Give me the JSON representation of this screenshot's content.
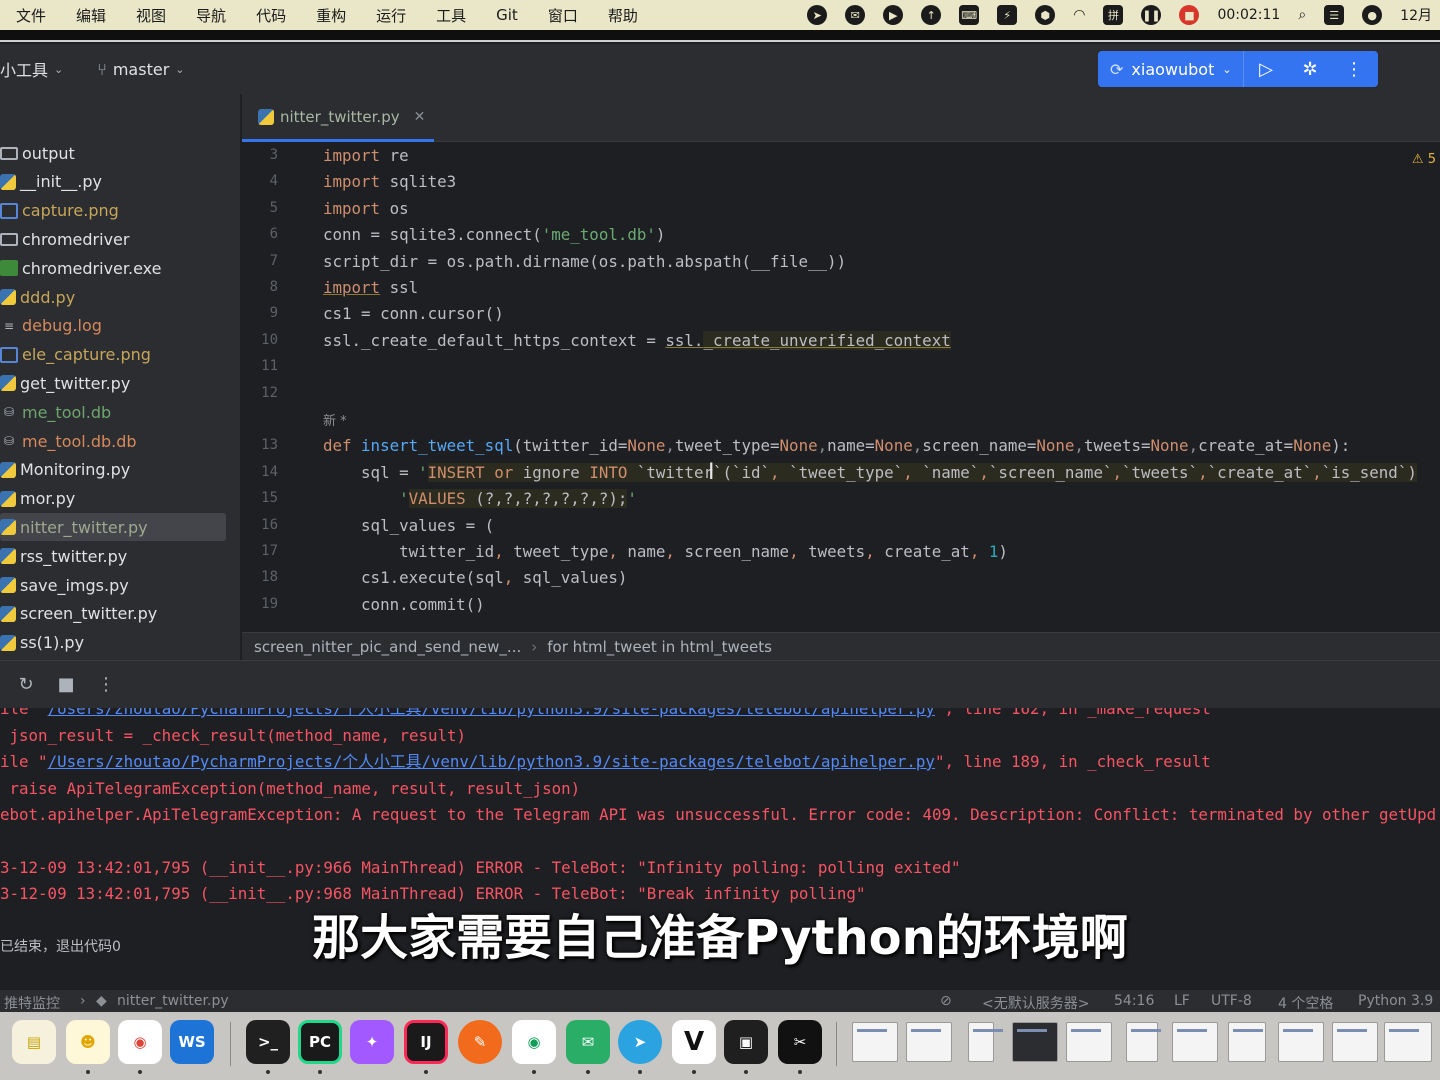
{
  "menubar": {
    "items": [
      "文件",
      "编辑",
      "视图",
      "导航",
      "代码",
      "重构",
      "运行",
      "工具",
      "Git",
      "窗口",
      "帮助"
    ],
    "clock": "00:02:11",
    "date": "12月"
  },
  "toolbar": {
    "project": "小工具",
    "branch": "master",
    "run_config": "xiaowubot"
  },
  "project_tree": [
    {
      "name": "output",
      "icon": "folder-icon",
      "color": "#dfe1e5"
    },
    {
      "name": "__init__.py",
      "icon": "python-file-icon",
      "color": "#dfe1e5"
    },
    {
      "name": "capture.png",
      "icon": "image-file-icon",
      "color": "#c7a65a"
    },
    {
      "name": "chromedriver",
      "icon": "file-icon",
      "color": "#dfe1e5"
    },
    {
      "name": "chromedriver.exe",
      "icon": "exe-file-icon",
      "color": "#dfe1e5"
    },
    {
      "name": "ddd.py",
      "icon": "python-file-icon",
      "color": "#c7a65a"
    },
    {
      "name": "debug.log",
      "icon": "text-file-icon",
      "color": "#d7895c"
    },
    {
      "name": "ele_capture.png",
      "icon": "image-file-icon",
      "color": "#c7a65a"
    },
    {
      "name": "get_twitter.py",
      "icon": "python-file-icon",
      "color": "#dfe1e5"
    },
    {
      "name": "me_tool.db",
      "icon": "database-icon",
      "color": "#6ea56e"
    },
    {
      "name": "me_tool.db.db",
      "icon": "database-icon",
      "color": "#d7895c"
    },
    {
      "name": "Monitoring.py",
      "icon": "python-file-icon",
      "color": "#dfe1e5"
    },
    {
      "name": "mor.py",
      "icon": "python-file-icon",
      "color": "#dfe1e5"
    },
    {
      "name": "nitter_twitter.py",
      "icon": "python-file-icon",
      "color": "#9fa88f"
    },
    {
      "name": "rss_twitter.py",
      "icon": "python-file-icon",
      "color": "#dfe1e5"
    },
    {
      "name": "save_imgs.py",
      "icon": "python-file-icon",
      "color": "#dfe1e5"
    },
    {
      "name": "screen_twitter.py",
      "icon": "python-file-icon",
      "color": "#dfe1e5"
    },
    {
      "name": "ss(1).py",
      "icon": "python-file-icon",
      "color": "#dfe1e5"
    }
  ],
  "editor": {
    "tab": "nitter_twitter.py",
    "warning_count": "5",
    "line_numbers": [
      "3",
      "4",
      "5",
      "6",
      "7",
      "8",
      "9",
      "10",
      "11",
      "12",
      "13",
      "14",
      "15",
      "16",
      "17",
      "18",
      "19"
    ],
    "hint_new": "新 *",
    "breadcrumbs": [
      "screen_nitter_pic_and_send_new_...",
      "for html_tweet in html_tweets"
    ]
  },
  "console": {
    "lines": [
      {
        "kind": "file",
        "prefix": "ile \"",
        "path": "/Users/zhoutao/PycharmProjects/个人小工具/venv/lib/python3.9/site-packages/telebot/apihelper.py",
        "suffix": "\", line 162, in _make_request"
      },
      {
        "kind": "text",
        "text": " json_result = _check_result(method_name, result)"
      },
      {
        "kind": "file",
        "prefix": "ile \"",
        "path": "/Users/zhoutao/PycharmProjects/个人小工具/venv/lib/python3.9/site-packages/telebot/apihelper.py",
        "suffix": "\", line 189, in _check_result"
      },
      {
        "kind": "text",
        "text": " raise ApiTelegramException(method_name, result, result_json)"
      },
      {
        "kind": "text",
        "text": "ebot.apihelper.ApiTelegramException: A request to the Telegram API was unsuccessful. Error code: 409. Description: Conflict: terminated by other getUpd"
      },
      {
        "kind": "text",
        "text": "3-12-09 13:42:01,795 (__init__.py:966 MainThread) ERROR - TeleBot: \"Infinity polling: polling exited\""
      },
      {
        "kind": "text",
        "text": "3-12-09 13:42:01,795 (__init__.py:968 MainThread) ERROR - TeleBot: \"Break infinity polling\""
      },
      {
        "kind": "gray",
        "text": "已结束，退出代码0"
      }
    ]
  },
  "subtitle": "那大家需要自己准备Python的环境啊",
  "statusbar": {
    "left_label": "推特监控",
    "left_file": "nitter_twitter.py",
    "server": "<无默认服务器>",
    "position": "54:16",
    "line_sep": "LF",
    "encoding": "UTF-8",
    "indent": "4 个空格",
    "interpreter": "Python 3.9"
  },
  "dock": {
    "apps": [
      "Notes",
      "Linux",
      "Chrome",
      "WebStorm",
      "Terminal",
      "PyCharm",
      "Figma",
      "IntelliJ IDEA",
      "Pages",
      "Chrome",
      "WeChat",
      "Telegram",
      "V",
      "Recorder",
      "CapCut"
    ]
  }
}
